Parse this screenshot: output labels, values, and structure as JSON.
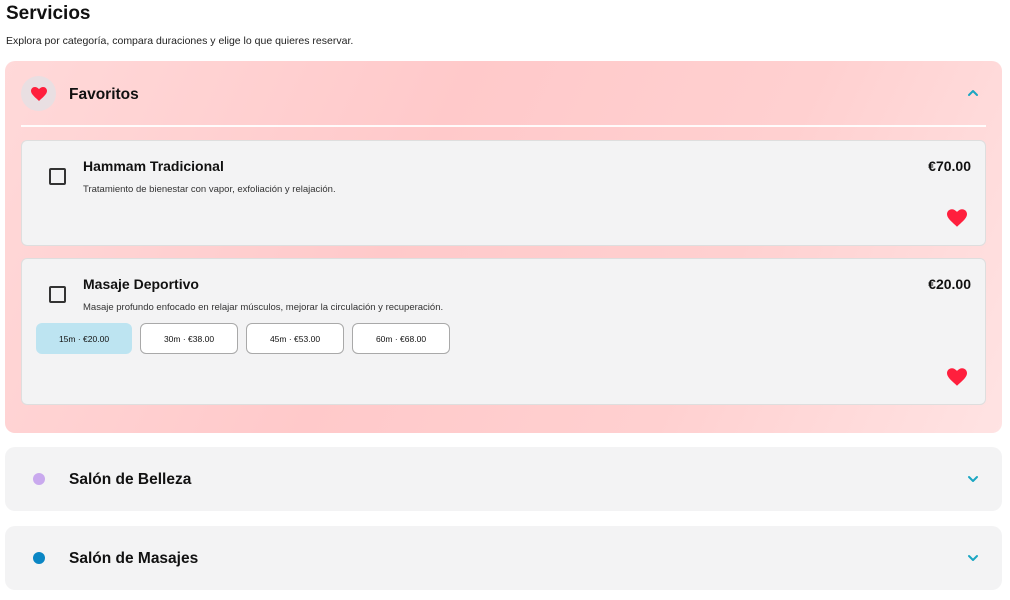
{
  "page": {
    "title": "Servicios",
    "subtitle": "Explora por categoría, compara duraciones y elige lo que quieres reservar."
  },
  "favorites": {
    "title": "Favoritos",
    "icon": "heart-icon",
    "expanded": true,
    "services": [
      {
        "name": "Hammam Tradicional",
        "description": "Tratamiento de bienestar con vapor, exfoliación y relajación.",
        "price": "€70.00",
        "favorite": true,
        "checked": false
      },
      {
        "name": "Masaje Deportivo",
        "description": "Masaje profundo enfocado en relajar músculos, mejorar la circulación y recuperación.",
        "price": "€20.00",
        "favorite": true,
        "checked": false,
        "durations": [
          {
            "label": "15m · €20.00",
            "selected": true
          },
          {
            "label": "30m · €38.00",
            "selected": false
          },
          {
            "label": "45m · €53.00",
            "selected": false
          },
          {
            "label": "60m · €68.00",
            "selected": false
          }
        ]
      }
    ]
  },
  "categories": [
    {
      "title": "Salón de Belleza",
      "dot_color": "#c9a9ee",
      "expanded": false
    },
    {
      "title": "Salón de Masajes",
      "dot_color": "#0a86c4",
      "expanded": false
    }
  ],
  "colors": {
    "heart": "#ff1f3d",
    "chevron": "#1aa6c2",
    "selected_duration": "#bde4f1"
  }
}
